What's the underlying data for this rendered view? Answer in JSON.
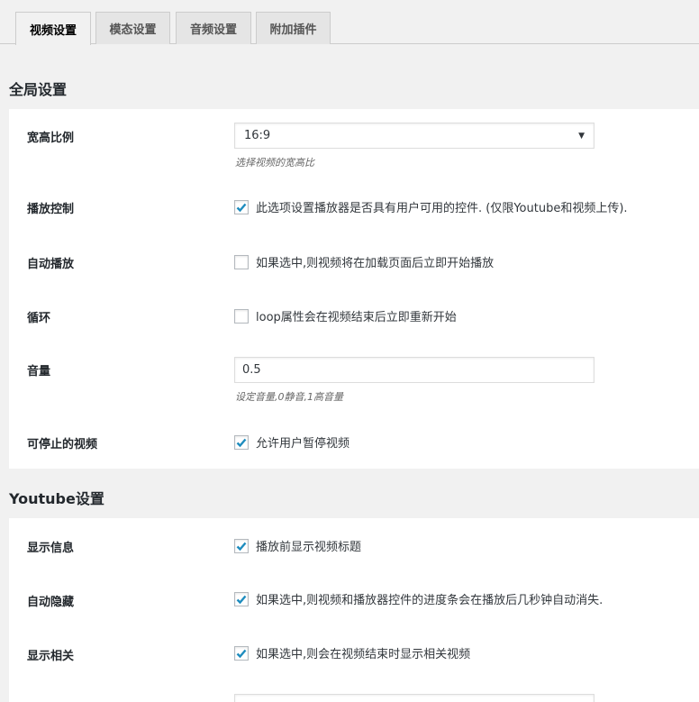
{
  "tabs": [
    {
      "label": "视频设置",
      "active": true
    },
    {
      "label": "模态设置",
      "active": false
    },
    {
      "label": "音频设置",
      "active": false
    },
    {
      "label": "附加插件",
      "active": false
    }
  ],
  "global": {
    "title": "全局设置",
    "aspect": {
      "label": "宽高比例",
      "value": "16:9",
      "desc": "选择视频的宽高比"
    },
    "controls": {
      "label": "播放控制",
      "checked": true,
      "text": "此选项设置播放器是否具有用户可用的控件. (仅限Youtube和视频上传)."
    },
    "autoplay": {
      "label": "自动播放",
      "checked": false,
      "text": "如果选中,则视频将在加载页面后立即开始播放"
    },
    "loop": {
      "label": "循环",
      "checked": false,
      "text": "loop属性会在视频结束后立即重新开始"
    },
    "volume": {
      "label": "音量",
      "value": "0.5",
      "desc": "设定音量,0静音,1高音量"
    },
    "pausable": {
      "label": "可停止的视频",
      "checked": true,
      "text": "允许用户暂停视频"
    }
  },
  "youtube": {
    "title": "Youtube设置",
    "showinfo": {
      "label": "显示信息",
      "checked": true,
      "text": "播放前显示视频标题"
    },
    "autohide": {
      "label": "自动隐藏",
      "checked": true,
      "text": "如果选中,则视频和播放器控件的进度条会在播放后几秒钟自动消失."
    },
    "related": {
      "label": "显示相关",
      "checked": true,
      "text": "如果选中,则会在视频结束时显示相关视频"
    }
  },
  "colors": {
    "accent": "#1e8cbe",
    "panel": "#ffffff",
    "background": "#f1f1f1"
  }
}
